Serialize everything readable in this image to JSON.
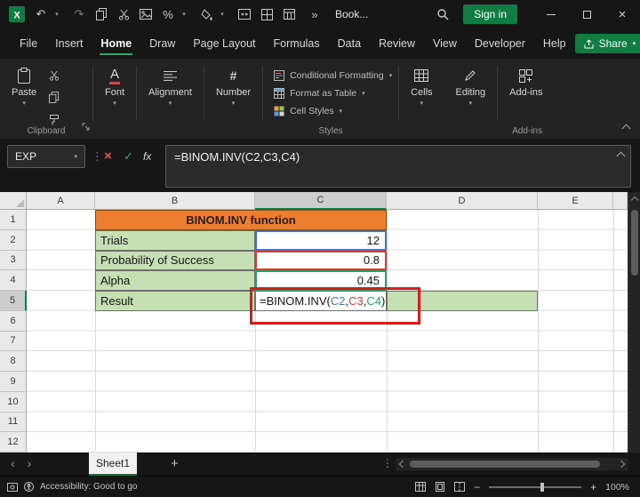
{
  "icons": {
    "undo": "↶",
    "redo": "↷",
    "caret": "▾",
    "more": "»",
    "dots": "⋮",
    "cancel": "×",
    "accept": "✓",
    "close": "×",
    "chevron_left": "‹",
    "chevron_right": "›",
    "plus": "+",
    "minus": "−",
    "percent": "%",
    "hash": "#",
    "letter_a": "A"
  },
  "titlebar": {
    "workbook_name": "Book...",
    "signin_label": "Sign in"
  },
  "menubar": {
    "tabs": [
      "File",
      "Insert",
      "Home",
      "Draw",
      "Page Layout",
      "Formulas",
      "Data",
      "Review",
      "View",
      "Developer",
      "Help"
    ],
    "active_tab": "Home",
    "share_label": "Share"
  },
  "ribbon": {
    "paste_label": "Paste",
    "font_label": "Font",
    "alignment_label": "Alignment",
    "number_label": "Number",
    "conditional_formatting_label": "Conditional Formatting",
    "format_as_table_label": "Format as Table",
    "cell_styles_label": "Cell Styles",
    "cells_label": "Cells",
    "editing_label": "Editing",
    "addins_label": "Add-ins",
    "clipboard_group_label": "Clipboard",
    "styles_group_label": "Styles",
    "addins_group_label": "Add-ins"
  },
  "formula_bar": {
    "name_box_value": "EXP",
    "fx_label": "fx",
    "formula": "=BINOM.INV(C2,C3,C4)"
  },
  "grid": {
    "columns": [
      "A",
      "B",
      "C",
      "D",
      "E"
    ],
    "rows": [
      "1",
      "2",
      "3",
      "4",
      "5",
      "6",
      "7",
      "8",
      "9",
      "10",
      "11",
      "12"
    ],
    "cells": {
      "title": "BINOM.INV function",
      "trials_label": "Trials",
      "trials_value": "12",
      "probability_label": "Probability of Success",
      "probability_value": "0.8",
      "alpha_label": "Alpha",
      "alpha_value": "0.45",
      "result_label": "Result"
    },
    "result_formula": {
      "prefix": "=BINOM.INV(",
      "ref1": "C2",
      "sep1": ",",
      "ref2": "C3",
      "sep2": ",",
      "ref3": "C4",
      "suffix": ")"
    }
  },
  "sheet_bar": {
    "sheet_name": "Sheet1"
  },
  "status_bar": {
    "accessibility_text": "Accessibility: Good to go",
    "zoom_level": "100%"
  },
  "colors": {
    "accent_green": "#107C41",
    "header_orange": "#ED7D31",
    "cell_green": "#C6E0B4",
    "ref_blue": "#4472C4",
    "ref_red": "#D83B32",
    "ref_green": "#2E9E68",
    "annotation_red": "#D81B1B"
  }
}
